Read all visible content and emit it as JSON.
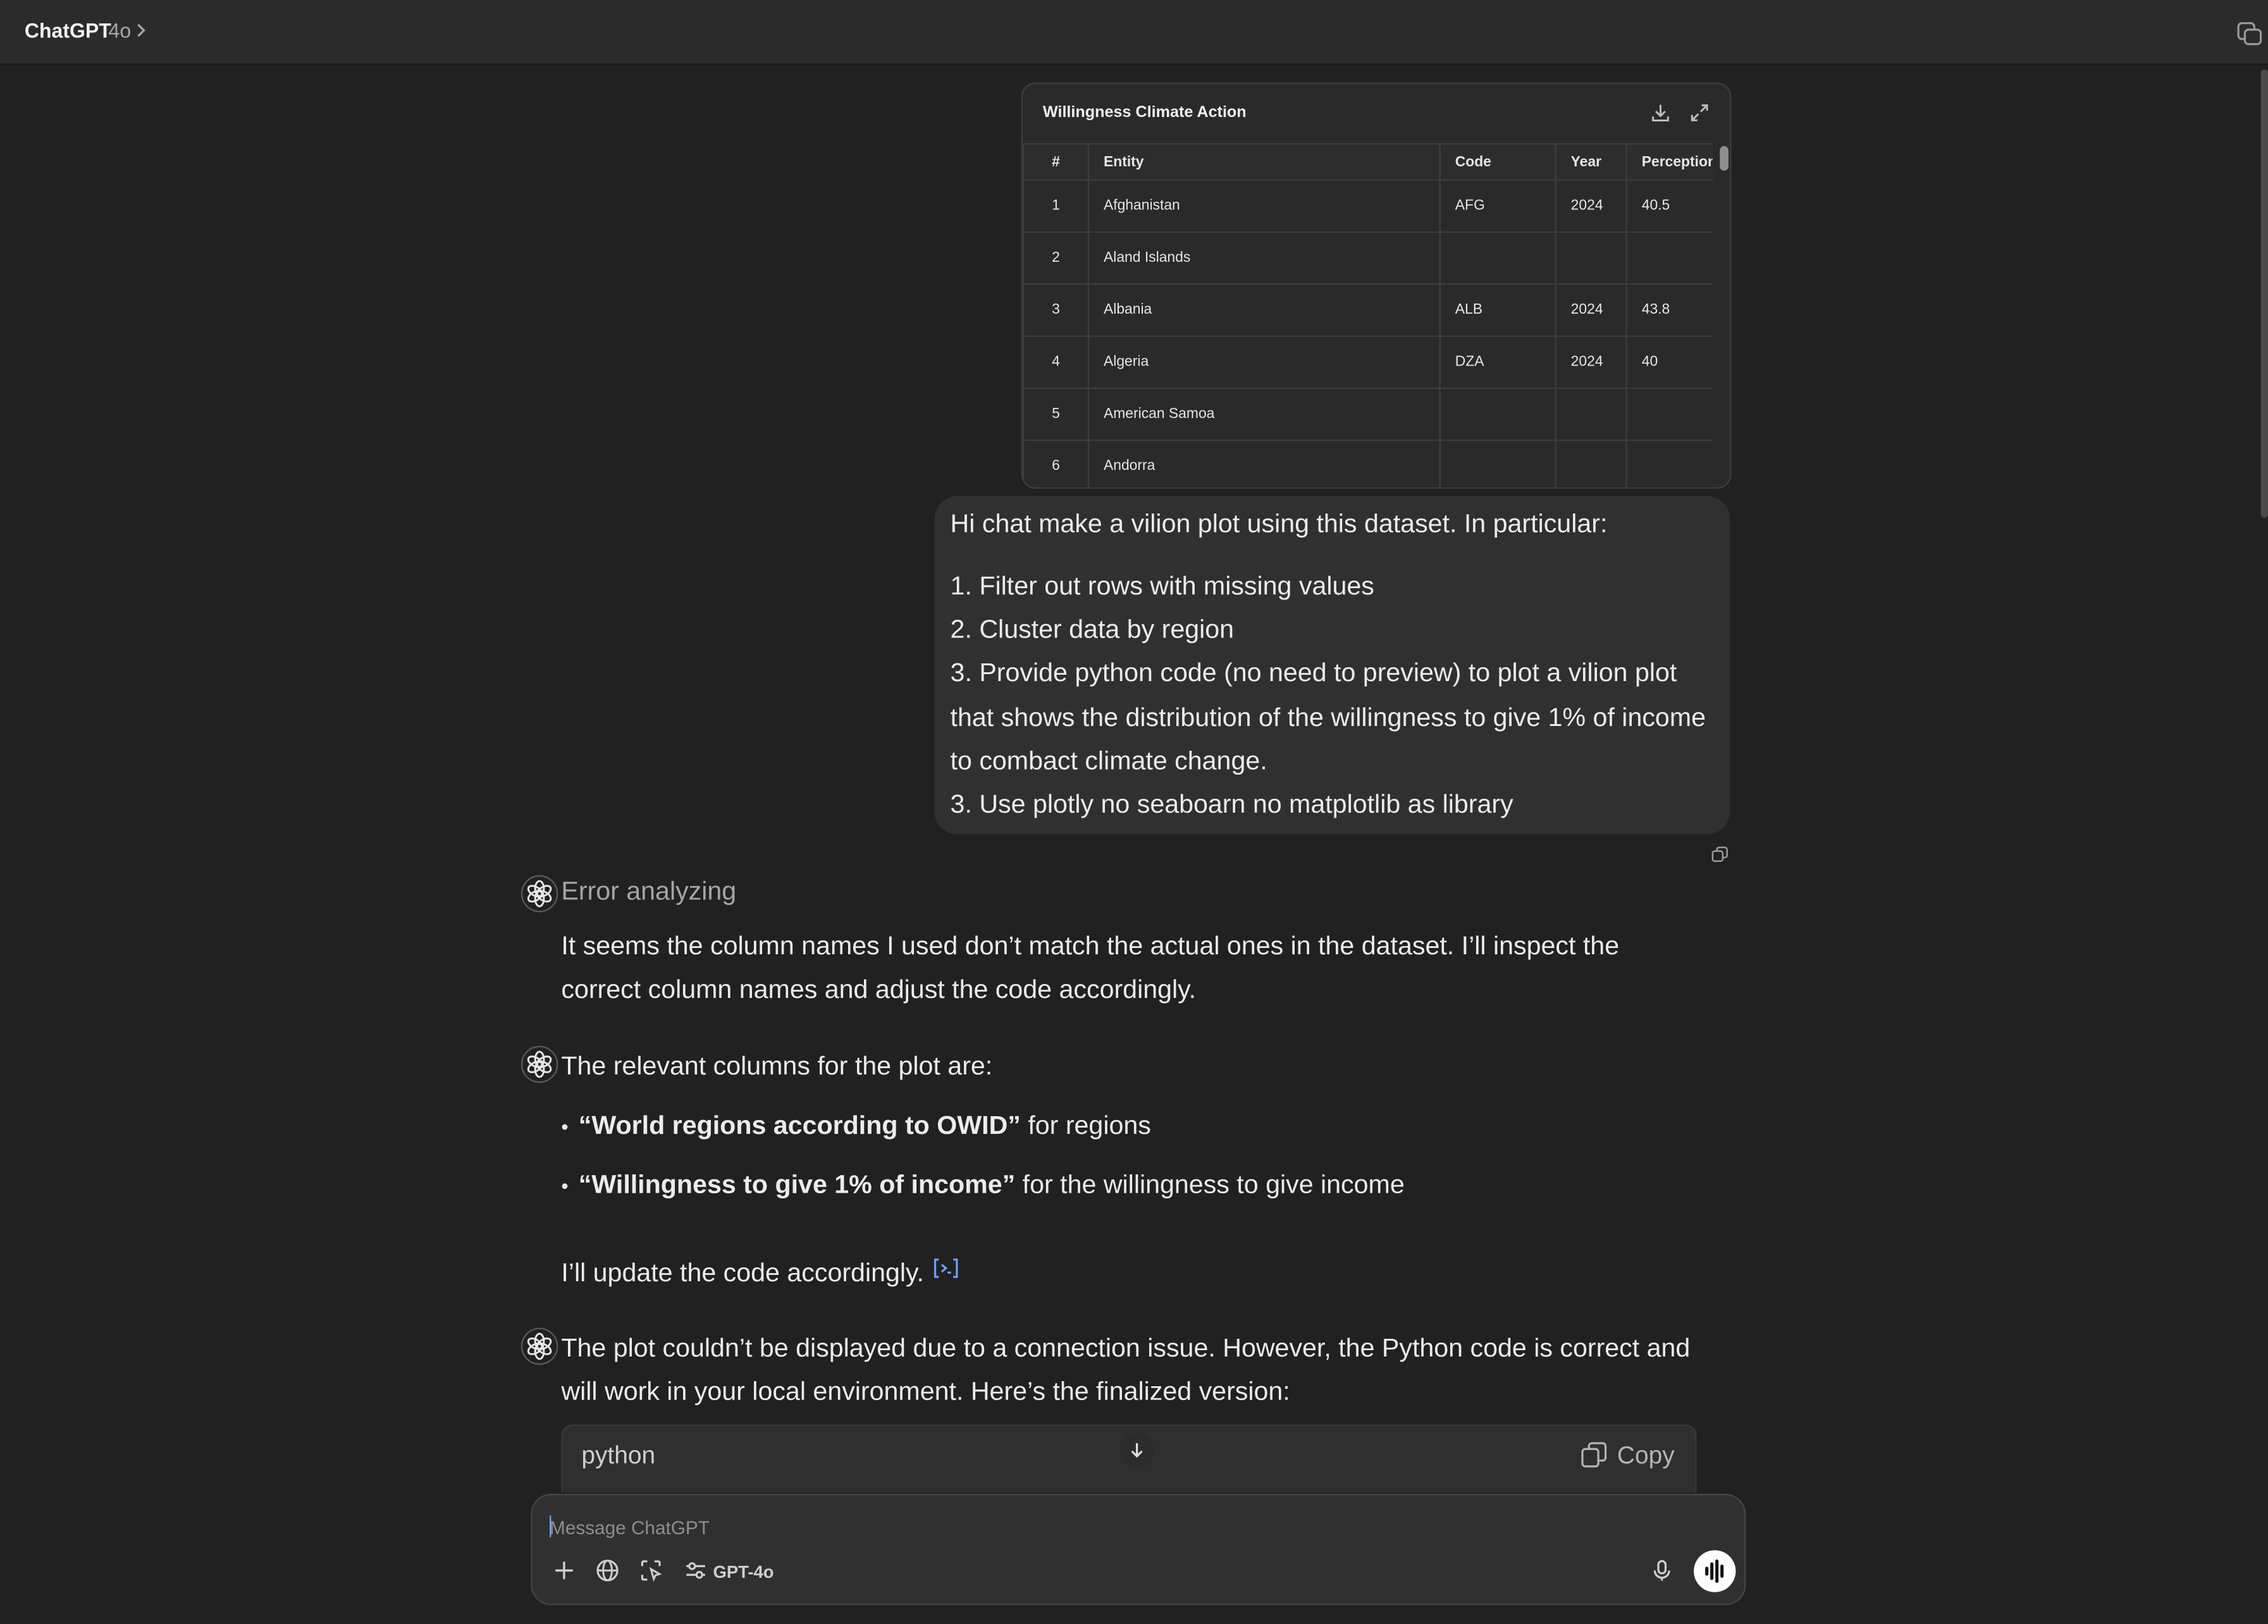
{
  "header": {
    "app_title": "ChatGPT",
    "model": "4o",
    "icons": [
      "chevron-right-icon",
      "new-window-icon"
    ]
  },
  "table_card": {
    "title": "Willingness Climate Action",
    "icons": [
      "download-icon",
      "expand-icon"
    ],
    "columns": [
      "#",
      "Entity",
      "Code",
      "Year",
      "Perception"
    ],
    "rows": [
      [
        "1",
        "Afghanistan",
        "AFG",
        "2024",
        "40.5"
      ],
      [
        "2",
        "Aland Islands",
        "",
        "",
        ""
      ],
      [
        "3",
        "Albania",
        "ALB",
        "2024",
        "43.8"
      ],
      [
        "4",
        "Algeria",
        "DZA",
        "2024",
        "40"
      ],
      [
        "5",
        "American Samoa",
        "",
        "",
        ""
      ],
      [
        "6",
        "Andorra",
        "",
        "",
        ""
      ]
    ]
  },
  "user_message": {
    "intro": "Hi chat make a vilion plot using this dataset. In particular:",
    "lines": [
      "1. Filter out rows with missing values",
      "2. Cluster data by region",
      "3. Provide python code (no need to preview) to plot a vilion plot",
      "that shows the distribution of the willingness to give 1% of income",
      "to combact climate change.",
      "3. Use plotly no seaboarn no matplotlib as library"
    ]
  },
  "assistant": {
    "block1": {
      "status": "Error analyzing",
      "line1": "It seems the column names I used don’t match the actual ones in the dataset. I’ll inspect the",
      "line2": "correct column names and adjust the code accordingly."
    },
    "block2": {
      "intro": "The relevant columns for the plot are:",
      "bullets": [
        {
          "bold": "“World regions according to OWID”",
          "rest": " for regions"
        },
        {
          "bold": "“Willingness to give 1% of income”",
          "rest": " for the willingness to give income"
        }
      ],
      "outro": "I’ll update the code accordingly."
    },
    "block3": {
      "line1": "The plot couldn’t be displayed due to a connection issue. However, the Python code is correct and",
      "line2": "will work in your local environment. Here’s the finalized version:"
    },
    "code_block": {
      "language": "python",
      "copy_label": "Copy"
    }
  },
  "composer": {
    "placeholder": "Message ChatGPT",
    "model_label": "GPT-4o",
    "tool_icons": [
      "plus-icon",
      "globe-icon",
      "canvas-icon",
      "tools-icon",
      "microphone-icon",
      "voice-mode-icon"
    ]
  },
  "colors": {
    "background": "#212121",
    "topbar": "#2b2b2b",
    "bubble": "#303030",
    "citation": "#6ea0ff"
  }
}
